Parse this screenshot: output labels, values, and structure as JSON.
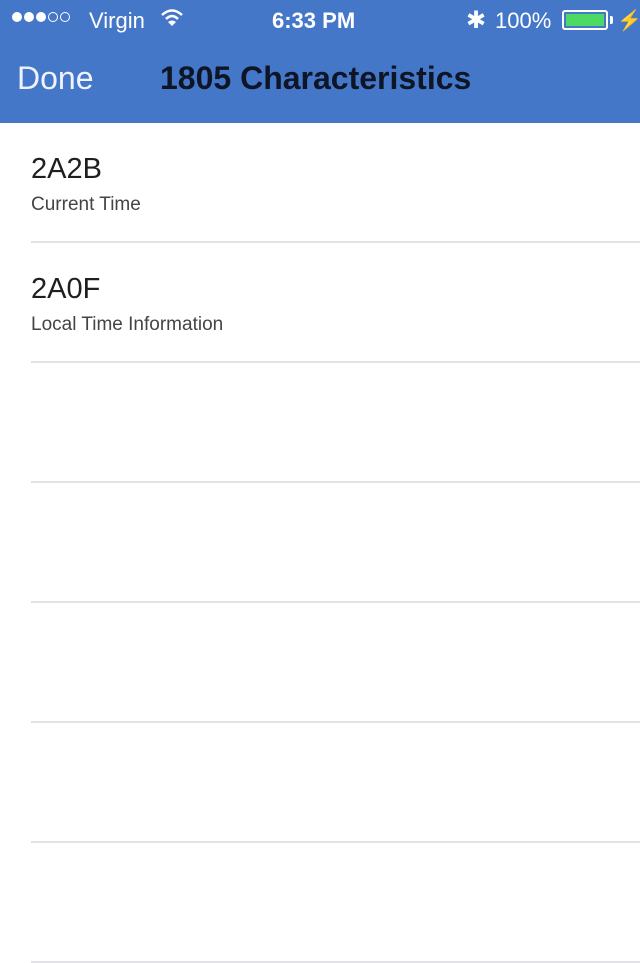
{
  "status_bar": {
    "carrier": "Virgin",
    "time": "6:33 PM",
    "battery": "100%",
    "signal_icon": "signal-dots-icon",
    "wifi_icon": "wifi-icon",
    "bluetooth_icon": "bluetooth-icon",
    "battery_icon": "battery-icon",
    "battery_color": "#4cd964"
  },
  "nav": {
    "done_label": "Done",
    "title": "1805 Characteristics",
    "background": "#4577c9"
  },
  "characteristics": [
    {
      "uuid": "2A2B",
      "name": "Current Time"
    },
    {
      "uuid": "2A0F",
      "name": "Local Time Information"
    }
  ]
}
